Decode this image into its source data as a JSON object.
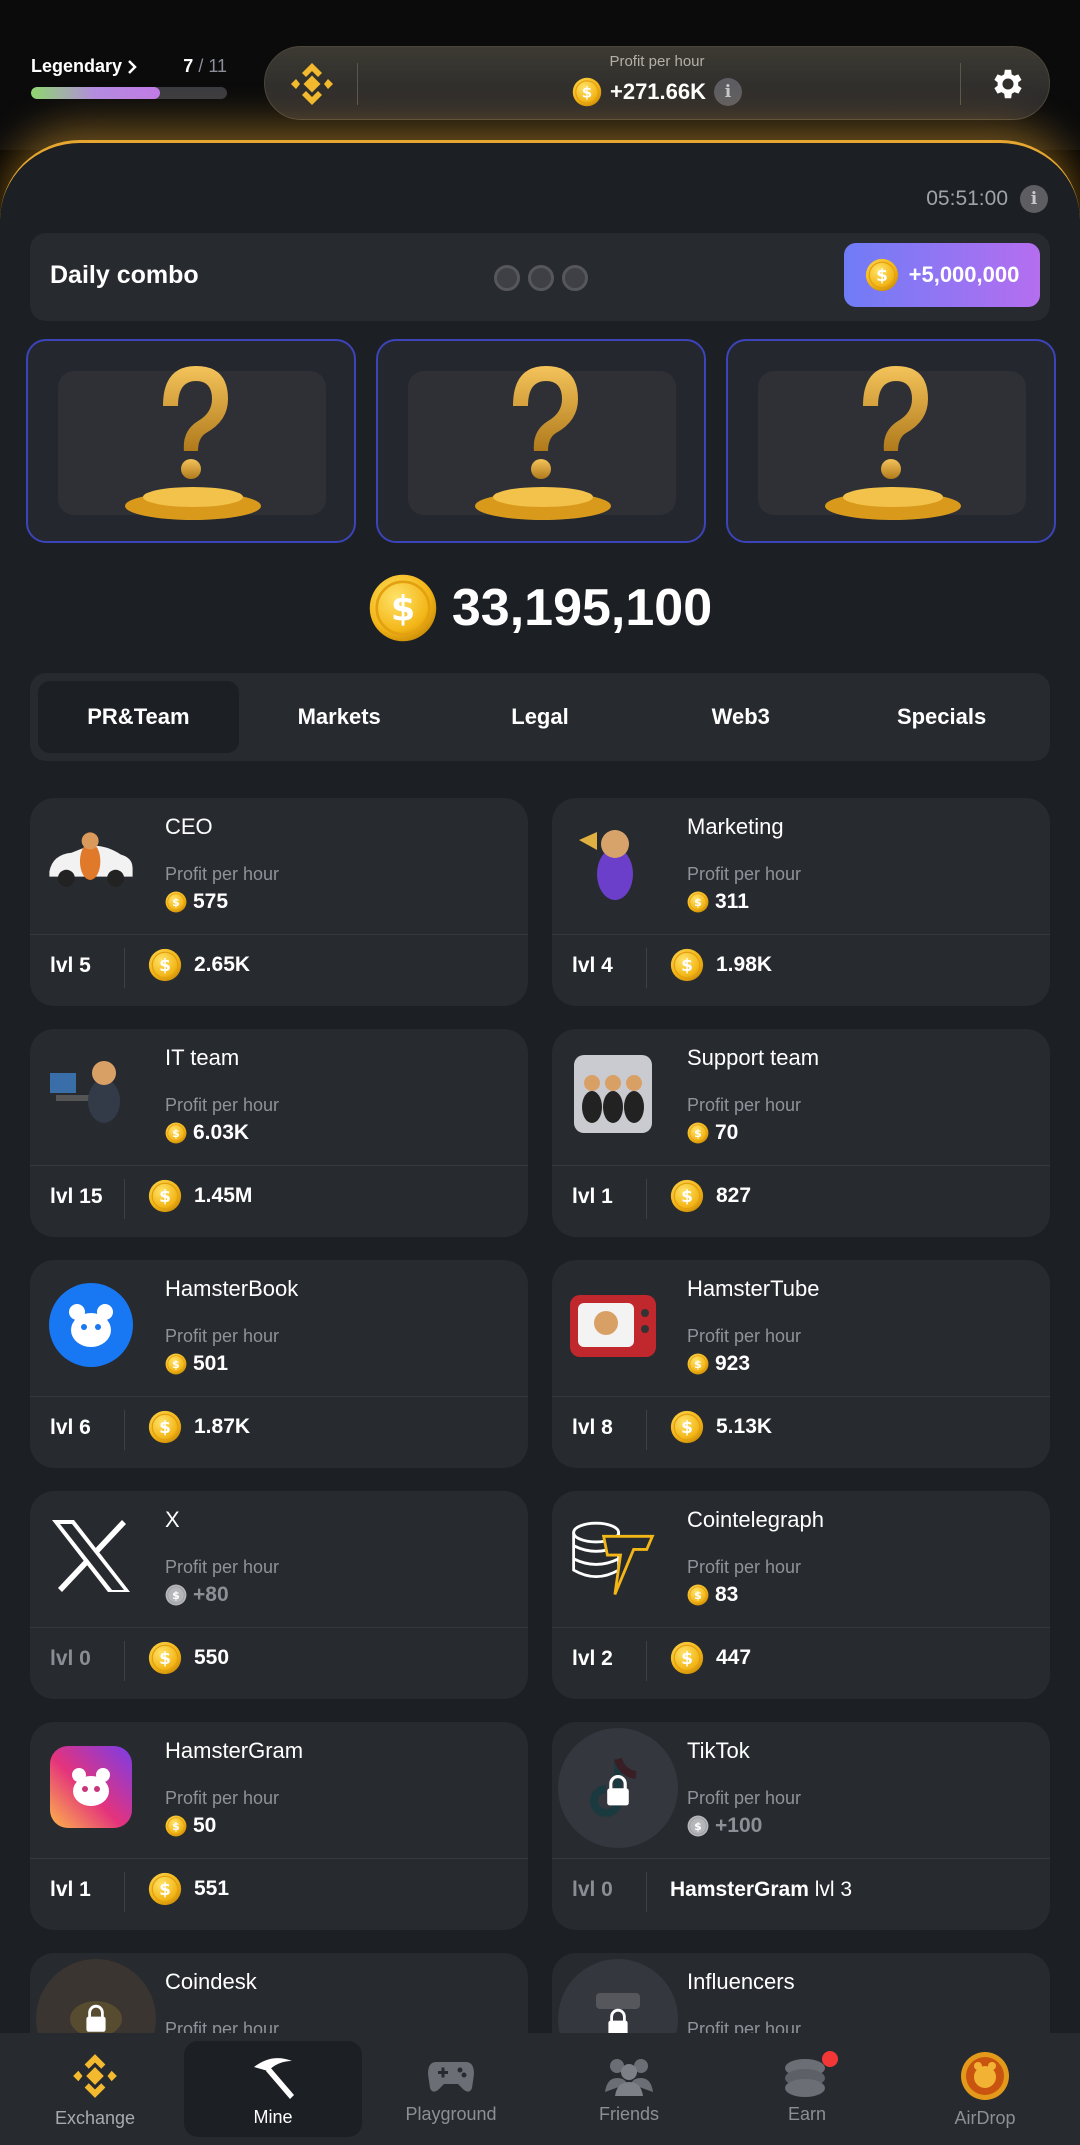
{
  "header": {
    "level_name": "Legendary",
    "level_current": "7",
    "level_total": "/ 11",
    "level_progress": 0.66,
    "profit_label": "Profit per hour",
    "profit_value": "+271.66K",
    "info_glyph": "i",
    "settings_icon": "gear-icon",
    "exchange_icon": "binance-logo-icon"
  },
  "timer": "05:51:00",
  "daily_combo": {
    "title": "Daily combo",
    "reward": "+5,000,000",
    "found": 0,
    "total": 3
  },
  "balance": "33,195,100",
  "tabs": [
    "PR&Team",
    "Markets",
    "Legal",
    "Web3",
    "Specials"
  ],
  "active_tab": "PR&Team",
  "cards": [
    {
      "name": "CEO",
      "pph_label": "Profit per hour",
      "pph": "575",
      "level": "lvl 5",
      "cost": "2.65K",
      "icon": "ceo-hamster-icon"
    },
    {
      "name": "Marketing",
      "pph_label": "Profit per hour",
      "pph": "311",
      "level": "lvl 4",
      "cost": "1.98K",
      "icon": "marketing-hamster-icon"
    },
    {
      "name": "IT team",
      "pph_label": "Profit per hour",
      "pph": "6.03K",
      "level": "lvl 15",
      "cost": "1.45M",
      "icon": "it-team-hamster-icon"
    },
    {
      "name": "Support team",
      "pph_label": "Profit per hour",
      "pph": "70",
      "level": "lvl 1",
      "cost": "827",
      "icon": "support-team-hamster-icon"
    },
    {
      "name": "HamsterBook",
      "pph_label": "Profit per hour",
      "pph": "501",
      "level": "lvl 6",
      "cost": "1.87K",
      "icon": "hamsterbook-icon"
    },
    {
      "name": "HamsterTube",
      "pph_label": "Profit per hour",
      "pph": "923",
      "level": "lvl 8",
      "cost": "5.13K",
      "icon": "hamstertube-icon"
    },
    {
      "name": "X",
      "pph_label": "Profit per hour",
      "pph": "+80",
      "level": "lvl 0",
      "cost": "550",
      "icon": "x-logo-icon"
    },
    {
      "name": "Cointelegraph",
      "pph_label": "Profit per hour",
      "pph": "83",
      "level": "lvl 2",
      "cost": "447",
      "icon": "cointelegraph-icon"
    },
    {
      "name": "HamsterGram",
      "pph_label": "Profit per hour",
      "pph": "50",
      "level": "lvl 1",
      "cost": "551",
      "icon": "hamstergram-icon"
    },
    {
      "name": "TikTok",
      "pph_label": "Profit per hour",
      "pph": "+100",
      "level": "lvl 0",
      "req_name": "HamsterGram",
      "req_level": "lvl 3",
      "icon": "tiktok-lock-icon"
    },
    {
      "name": "Coindesk",
      "pph_label": "Profit per hour",
      "icon": "coindesk-lock-icon"
    },
    {
      "name": "Influencers",
      "pph_label": "Profit per hour",
      "icon": "influencers-lock-icon"
    }
  ],
  "nav": [
    {
      "label": "Exchange",
      "icon": "binance-logo-icon"
    },
    {
      "label": "Mine",
      "icon": "pickaxe-icon"
    },
    {
      "label": "Playground",
      "icon": "gamepad-icon"
    },
    {
      "label": "Friends",
      "icon": "friends-icon"
    },
    {
      "label": "Earn",
      "icon": "coins-icon"
    },
    {
      "label": "AirDrop",
      "icon": "airdrop-coin-icon"
    }
  ],
  "active_nav": "Mine",
  "colors": {
    "accent_gold": "#e7a630",
    "panel_bg": "#1c1f24",
    "card_bg": "#272a2f",
    "combo_gradient_start": "#6f7cf6",
    "combo_gradient_end": "#b56ef0"
  }
}
